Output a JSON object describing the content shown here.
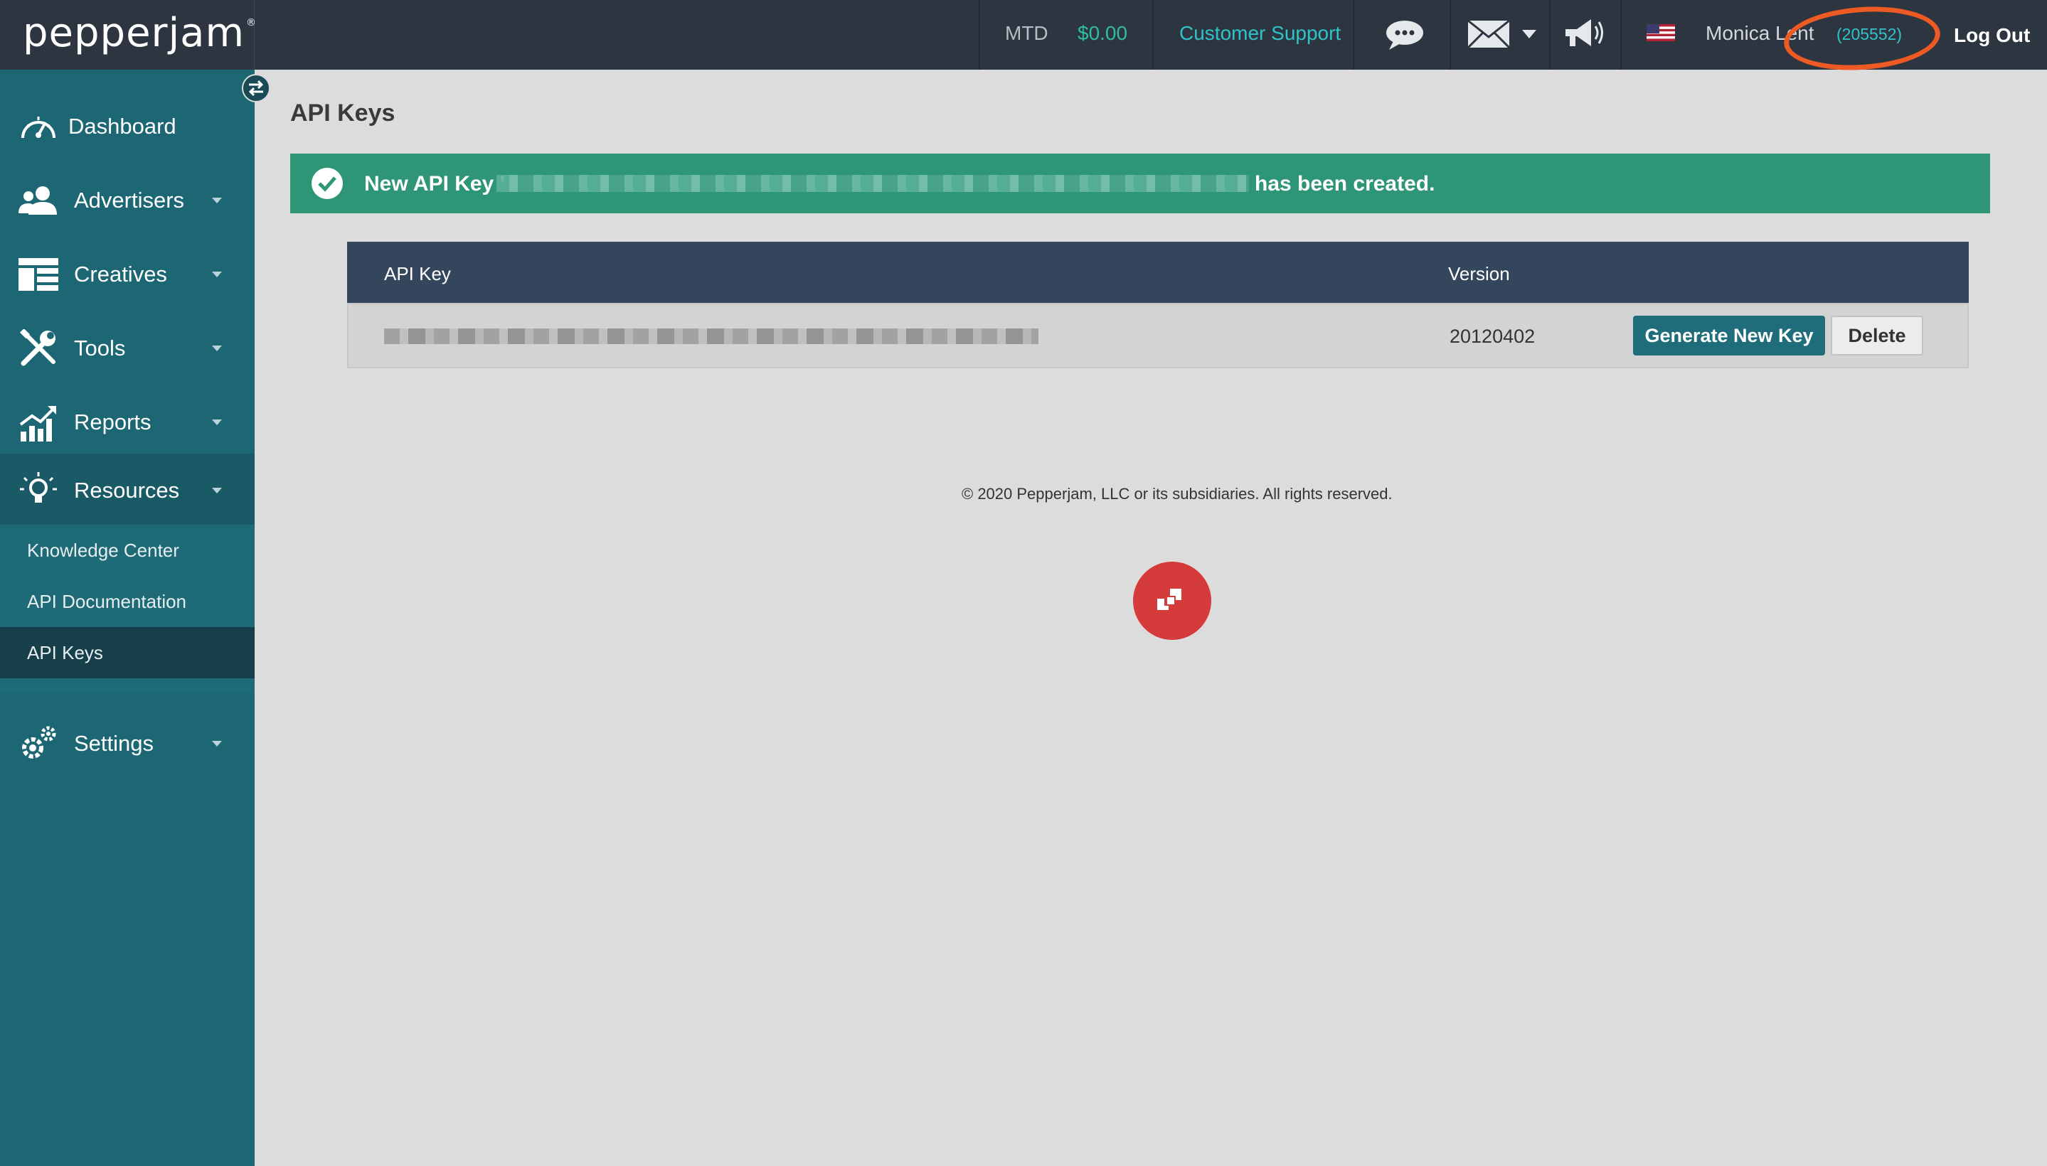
{
  "topbar": {
    "logo": "pepperjam",
    "logo_mark": "®",
    "mtd_label": "MTD",
    "mtd_value": "$0.00",
    "support_link": "Customer Support",
    "user_name": "Monica Lent",
    "user_id": "(205552)",
    "logout": "Log Out",
    "icons": [
      "chat-bubbles-icon",
      "mail-icon",
      "megaphone-icon",
      "us-flag-icon"
    ],
    "accent_color": "#31c3c9"
  },
  "sidebar": {
    "items": [
      {
        "label": "Dashboard",
        "icon": "speedometer-icon"
      },
      {
        "label": "Advertisers",
        "icon": "users-icon"
      },
      {
        "label": "Creatives",
        "icon": "layout-icon"
      },
      {
        "label": "Tools",
        "icon": "tools-icon"
      },
      {
        "label": "Reports",
        "icon": "chart-icon"
      },
      {
        "label": "Resources",
        "icon": "lightbulb-icon"
      },
      {
        "label": "Settings",
        "icon": "gears-icon"
      }
    ],
    "sub_items": [
      {
        "label": "Knowledge Center"
      },
      {
        "label": "API Documentation"
      },
      {
        "label": "API Keys"
      }
    ]
  },
  "main": {
    "title": "API Keys",
    "alert": {
      "prefix": "New API Key '",
      "suffix": " has been created."
    },
    "table": {
      "headers": [
        "API Key",
        "Version"
      ],
      "rows": [
        {
          "version": "20120402"
        }
      ],
      "generate_label": "Generate New Key",
      "delete_label": "Delete"
    },
    "footer": "© 2020 Pepperjam, LLC or its subsidiaries. All rights reserved."
  }
}
